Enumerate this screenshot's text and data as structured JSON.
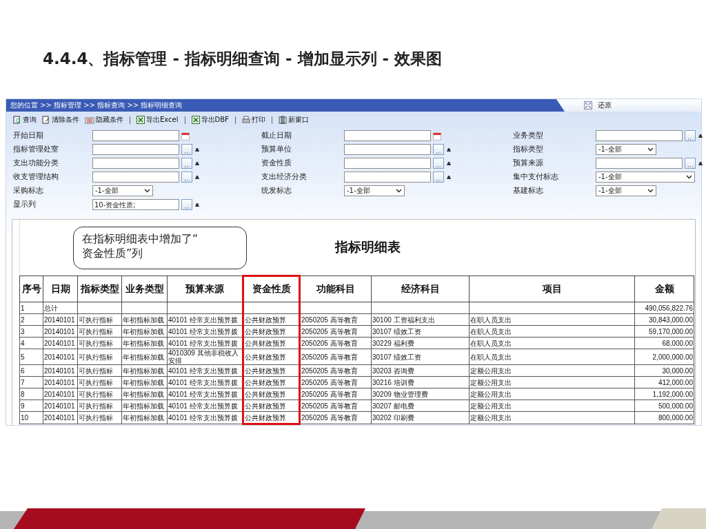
{
  "slide_title": "4.4.4、指标管理 - 指标明细查询 - 增加显示列 - 效果图",
  "app": {
    "breadcrumb": "您的位置 >> 指标管理 >> 指标查询 >> 指标明细查询",
    "restore_label": "还原",
    "toolbar": [
      {
        "kind": "query",
        "label": "查询",
        "separator_before": false
      },
      {
        "kind": "clear",
        "label": "清除条件",
        "separator_before": false
      },
      {
        "kind": "hide",
        "label": "隐藏条件",
        "separator_before": false
      },
      {
        "kind": "excel",
        "label": "导出Excel",
        "separator_before": true
      },
      {
        "kind": "excel",
        "label": "导出DBF",
        "separator_before": true
      },
      {
        "kind": "print",
        "label": "打印",
        "separator_before": true
      },
      {
        "kind": "window",
        "label": "新窗口",
        "separator_before": true
      }
    ],
    "form": [
      {
        "label": "开始日期",
        "kind": "date"
      },
      {
        "label": "截止日期",
        "kind": "date"
      },
      {
        "label": "业务类型",
        "kind": "picker"
      },
      {
        "label": "指标管理处室",
        "kind": "picker"
      },
      {
        "label": "预算单位",
        "kind": "picker"
      },
      {
        "label": "指标类型",
        "kind": "select",
        "value": "-1-全部"
      },
      {
        "label": "支出功能分类",
        "kind": "picker"
      },
      {
        "label": "资金性质",
        "kind": "picker"
      },
      {
        "label": "预算来源",
        "kind": "picker"
      },
      {
        "label": "收支管理结构",
        "kind": "picker"
      },
      {
        "label": "支出经济分类",
        "kind": "picker"
      },
      {
        "label": "集中支付标志",
        "kind": "select",
        "value": "-1-全部",
        "wide": true
      },
      {
        "label": "采购标志",
        "kind": "select",
        "value": "-1-全部"
      },
      {
        "label": "统发标志",
        "kind": "select",
        "value": "-1-全部"
      },
      {
        "label": "基建标志",
        "kind": "select",
        "value": "-1-全部"
      },
      {
        "label": "显示列",
        "kind": "picker",
        "value": "10-资金性质;"
      }
    ],
    "report": {
      "title": "指标明细表",
      "callout": "在指标明细表中增加了“\n资金性质”列",
      "columns": [
        {
          "label": "序号",
          "highlighted": false
        },
        {
          "label": "日期",
          "highlighted": false
        },
        {
          "label": "指标类型",
          "highlighted": false
        },
        {
          "label": "业务类型",
          "highlighted": false
        },
        {
          "label": "预算来源",
          "highlighted": false
        },
        {
          "label": "资金性质",
          "highlighted": true
        },
        {
          "label": "功能科目",
          "highlighted": false
        },
        {
          "label": "经济科目",
          "highlighted": false
        },
        {
          "label": "项目",
          "highlighted": false
        },
        {
          "label": "金额",
          "highlighted": false
        }
      ],
      "rows": [
        [
          "1",
          "总计",
          "",
          "",
          "",
          "",
          "",
          "",
          "",
          "490,056,822.76"
        ],
        [
          "2",
          "20140101",
          "可执行指标",
          "年初指标加载",
          "40101 经常支出预算拨",
          "公共财政预算",
          "2050205 高等教育",
          "30100 工资福利支出",
          "在职人员支出",
          "30,843,000.00"
        ],
        [
          "3",
          "20140101",
          "可执行指标",
          "年初指标加载",
          "40101 经常支出预算拨",
          "公共财政预算",
          "2050205 高等教育",
          "30107 绩效工资",
          "在职人员支出",
          "59,170,000.00"
        ],
        [
          "4",
          "20140101",
          "可执行指标",
          "年初指标加载",
          "40101 经常支出预算拨",
          "公共财政预算",
          "2050205 高等教育",
          "30229 福利费",
          "在职人员支出",
          "68,000.00"
        ],
        [
          "5",
          "20140101",
          "可执行指标",
          "年初指标加载",
          "4010309 其他非税收入安排",
          "公共财政预算",
          "2050205 高等教育",
          "30107 绩效工资",
          "在职人员支出",
          "2,000,000.00"
        ],
        [
          "6",
          "20140101",
          "可执行指标",
          "年初指标加载",
          "40101 经常支出预算拨",
          "公共财政预算",
          "2050205 高等教育",
          "30203 咨询费",
          "定额公用支出",
          "30,000.00"
        ],
        [
          "7",
          "20140101",
          "可执行指标",
          "年初指标加载",
          "40101 经常支出预算拨",
          "公共财政预算",
          "2050205 高等教育",
          "30216 培训费",
          "定额公用支出",
          "412,000.00"
        ],
        [
          "8",
          "20140101",
          "可执行指标",
          "年初指标加载",
          "40101 经常支出预算拨",
          "公共财政预算",
          "2050205 高等教育",
          "30209 物业管理费",
          "定额公用支出",
          "1,192,000.00"
        ],
        [
          "9",
          "20140101",
          "可执行指标",
          "年初指标加载",
          "40101 经常支出预算拨",
          "公共财政预算",
          "2050205 高等教育",
          "30207 邮电费",
          "定额公用支出",
          "500,000.00"
        ],
        [
          "10",
          "20140101",
          "可执行指标",
          "年初指标加载",
          "40101 经常支出预算拨",
          "公共财政预算",
          "2050205 高等教育",
          "30202 印刷费",
          "定额公用支出",
          "800,000.00"
        ]
      ]
    }
  }
}
